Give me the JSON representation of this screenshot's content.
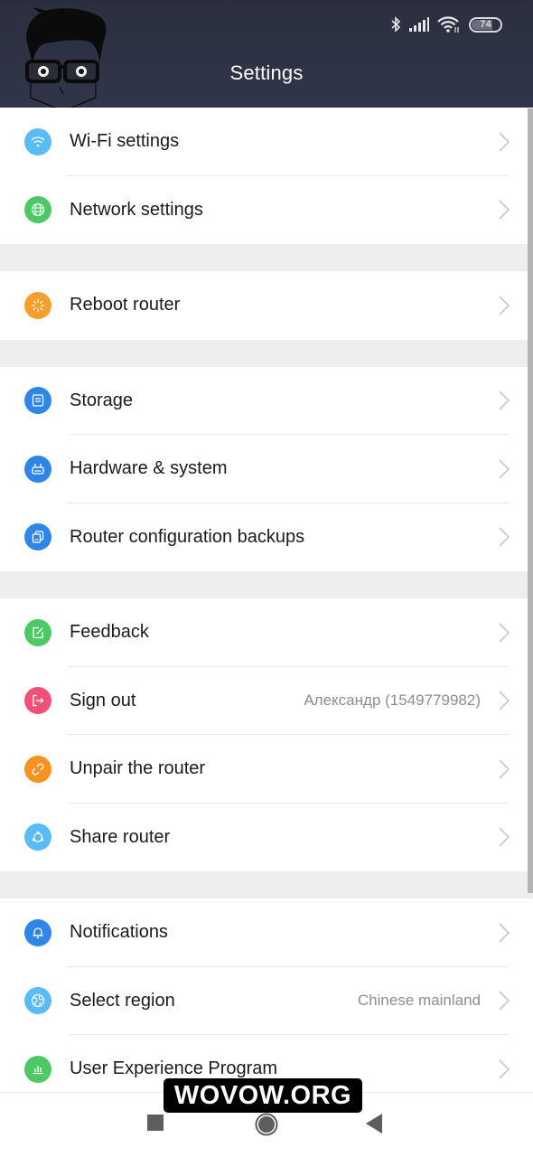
{
  "status_bar": {
    "icons": [
      "bluetooth-icon",
      "cellular-signal-icon",
      "wifi-icon",
      "battery-icon"
    ],
    "battery_level": "74",
    "battery_percent": 74
  },
  "header": {
    "title": "Settings",
    "logo": "cartoon-avatar-logo"
  },
  "settings": {
    "groups": [
      {
        "items": [
          {
            "label": "Wi-Fi settings",
            "icon": "wifi-icon",
            "color": "#5bbcf5",
            "value": ""
          },
          {
            "label": "Network settings",
            "icon": "globe-icon",
            "color": "#4cc964",
            "value": ""
          }
        ]
      },
      {
        "items": [
          {
            "label": "Reboot router",
            "icon": "reboot-icon",
            "color": "#f5a02e",
            "value": ""
          }
        ]
      },
      {
        "items": [
          {
            "label": "Storage",
            "icon": "storage-icon",
            "color": "#2f86e6",
            "value": ""
          },
          {
            "label": "Hardware & system",
            "icon": "router-hardware-icon",
            "color": "#2f86e6",
            "value": ""
          },
          {
            "label": "Router configuration backups",
            "icon": "backup-copy-icon",
            "color": "#2f86e6",
            "value": ""
          }
        ]
      },
      {
        "items": [
          {
            "label": "Feedback",
            "icon": "feedback-edit-icon",
            "color": "#4cc964",
            "value": ""
          },
          {
            "label": "Sign out",
            "icon": "sign-out-icon",
            "color": "#ef5178",
            "value": "Александр (1549779982)"
          },
          {
            "label": "Unpair the router",
            "icon": "link-icon",
            "color": "#f7921e",
            "value": ""
          },
          {
            "label": "Share router",
            "icon": "share-icon",
            "color": "#5bbcf5",
            "value": ""
          }
        ]
      },
      {
        "items": [
          {
            "label": "Notifications",
            "icon": "bell-icon",
            "color": "#2f86e6",
            "value": ""
          },
          {
            "label": "Select region",
            "icon": "region-globe-icon",
            "color": "#5bbcf5",
            "value": "Chinese mainland"
          },
          {
            "label": "User Experience Program",
            "icon": "bar-chart-icon",
            "color": "#4cc964",
            "value": ""
          }
        ]
      }
    ]
  },
  "navbar": {
    "buttons": [
      "recents-button",
      "home-button",
      "back-button"
    ]
  },
  "watermark": {
    "text": "WOVOW.ORG"
  },
  "colors": {
    "header_bg": "#2e3243",
    "group_gap": "#eeeeee",
    "label_text": "#1b1b1b",
    "value_text": "#8d8d8d",
    "chevron": "#c8c8c8"
  }
}
